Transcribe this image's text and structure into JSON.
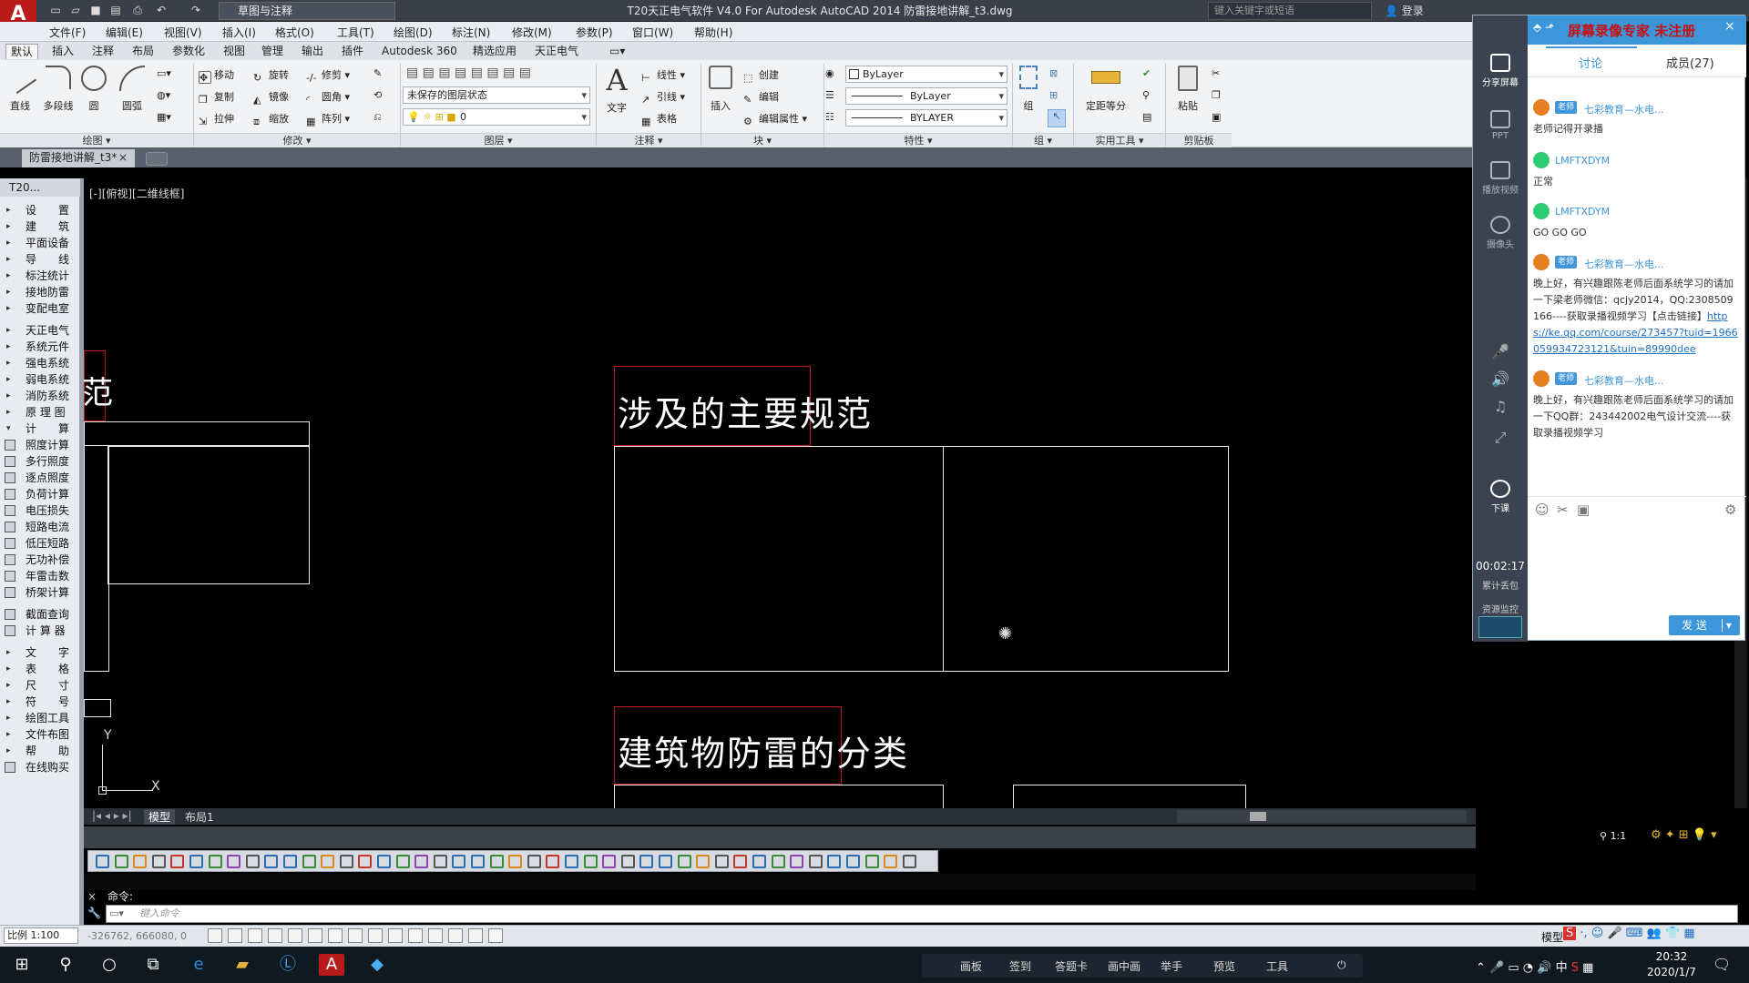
{
  "window": {
    "title": "T20天正电气软件 V4.0 For Autodesk AutoCAD 2014    防雷接地讲解_t3.dwg",
    "workspace": "草图与注释",
    "search_placeholder": "键入关键字或短语",
    "login": "登录",
    "logo": "A"
  },
  "menu": [
    "文件(F)",
    "编辑(E)",
    "视图(V)",
    "插入(I)",
    "格式(O)",
    "工具(T)",
    "绘图(D)",
    "标注(N)",
    "修改(M)",
    "参数(P)",
    "窗口(W)",
    "帮助(H)"
  ],
  "ribbon_tabs": [
    "默认",
    "插入",
    "注释",
    "布局",
    "参数化",
    "视图",
    "管理",
    "输出",
    "插件",
    "Autodesk 360",
    "精选应用",
    "天正电气"
  ],
  "ribbon": {
    "draw": {
      "panel": "绘图 ▾",
      "line": "直线",
      "polyline": "多段线",
      "circle": "圆",
      "arc": "圆弧"
    },
    "modify": {
      "panel": "修改 ▾",
      "move": "移动",
      "rotate": "旋转",
      "trim": "修剪",
      "copy": "复制",
      "mirror": "镜像",
      "fillet": "圆角",
      "stretch": "拉伸",
      "scale": "缩放",
      "array": "阵列"
    },
    "layers": {
      "panel": "图层 ▾",
      "layer_state": "未保存的图层状态",
      "current_layer": "0"
    },
    "annotation": {
      "panel": "注释 ▾",
      "text": "文字",
      "linear": "线性",
      "leader": "引线",
      "table": "表格"
    },
    "block": {
      "panel": "块 ▾",
      "insert": "插入",
      "create": "创建",
      "edit": "编辑",
      "edit_attr": "编辑属性"
    },
    "properties": {
      "panel": "特性 ▾",
      "color": "ByLayer",
      "linetype": "ByLayer",
      "lineweight": "BYLAYER"
    },
    "group": {
      "panel": "组 ▾",
      "group": "组"
    },
    "utilities": {
      "panel": "实用工具 ▾",
      "measure": "定距等分"
    },
    "clipboard": {
      "panel": "剪贴板",
      "paste": "粘贴"
    }
  },
  "doc_tab": {
    "label": "防雷接地讲解_t3*",
    "close": "×"
  },
  "view_label": "[-][俯视][二维线框]",
  "sidebar": {
    "title": "T20...",
    "items": [
      {
        "label": "设　　置",
        "kind": "arrow"
      },
      {
        "label": "建　　筑",
        "kind": "arrow"
      },
      {
        "label": "平面设备",
        "kind": "arrow"
      },
      {
        "label": "导　　线",
        "kind": "arrow"
      },
      {
        "label": "标注统计",
        "kind": "arrow"
      },
      {
        "label": "接地防雷",
        "kind": "arrow"
      },
      {
        "label": "变配电室",
        "kind": "arrow"
      },
      {
        "label": "天正电气",
        "kind": "arrow",
        "gap": true
      },
      {
        "label": "系统元件",
        "kind": "arrow"
      },
      {
        "label": "强电系统",
        "kind": "arrow"
      },
      {
        "label": "弱电系统",
        "kind": "arrow"
      },
      {
        "label": "消防系统",
        "kind": "arrow"
      },
      {
        "label": "原 理 图",
        "kind": "arrow"
      },
      {
        "label": "计　　算",
        "kind": "open"
      },
      {
        "label": "照度计算",
        "kind": "icon"
      },
      {
        "label": "多行照度",
        "kind": "icon"
      },
      {
        "label": "逐点照度",
        "kind": "icon"
      },
      {
        "label": "负荷计算",
        "kind": "icon"
      },
      {
        "label": "电压损失",
        "kind": "icon"
      },
      {
        "label": "短路电流",
        "kind": "icon"
      },
      {
        "label": "低压短路",
        "kind": "icon"
      },
      {
        "label": "无功补偿",
        "kind": "icon"
      },
      {
        "label": "年雷击数",
        "kind": "icon"
      },
      {
        "label": "桥架计算",
        "kind": "icon"
      },
      {
        "label": "截面查询",
        "kind": "icon",
        "gap": true
      },
      {
        "label": "计 算 器",
        "kind": "icon"
      },
      {
        "label": "文　　字",
        "kind": "arrow",
        "gap": true
      },
      {
        "label": "表　　格",
        "kind": "arrow"
      },
      {
        "label": "尺　　寸",
        "kind": "arrow"
      },
      {
        "label": "符　　号",
        "kind": "arrow"
      },
      {
        "label": "绘图工具",
        "kind": "arrow"
      },
      {
        "label": "文件布图",
        "kind": "arrow"
      },
      {
        "label": "帮　　助",
        "kind": "arrow"
      },
      {
        "label": "在线购买",
        "kind": "icon"
      }
    ]
  },
  "drawing": {
    "heading1": "涉及的主要规范",
    "heading2": "建筑物防雷的分类",
    "partial": "范",
    "ucs_y": "Y",
    "ucs_x": "X"
  },
  "layout_tabs": [
    "模型",
    "布局1"
  ],
  "status_strip": {
    "scale": "1:1"
  },
  "command": {
    "label": "命令:",
    "placeholder": "键入命令"
  },
  "statusbar": {
    "scale": "比例 1:100",
    "coords": "-326762, 666080, 0",
    "model": "模型"
  },
  "taskbar": {
    "live_items": [
      "画板",
      "签到",
      "答题卡",
      "画中画",
      "举手",
      "预览",
      "工具"
    ],
    "time": "20:32",
    "date": "2020/1/7",
    "tray_ime": "中"
  },
  "recorder": {
    "title": "屏幕录像专家  未注册",
    "tabs": [
      "讨论",
      "成员(27)"
    ],
    "left_buttons": [
      "分享屏幕",
      "PPT",
      "播放视频",
      "摄像头",
      "下课"
    ],
    "timer": "00:02:17",
    "stats1": "累计丢包",
    "stats2": "资源监控",
    "send": "发 送",
    "messages": [
      {
        "badge": "老师",
        "user": "七彩教育—水电...",
        "text": "老师记得开录播",
        "role": "teacher"
      },
      {
        "badge": "",
        "user": "LMFTXDYM",
        "text": "正常",
        "role": "student"
      },
      {
        "badge": "",
        "user": "LMFTXDYM",
        "text": "GO GO GO",
        "role": "student"
      },
      {
        "badge": "老师",
        "user": "七彩教育—水电...",
        "text": "晚上好，有兴趣跟陈老师后面系统学习的请加一下梁老师微信：qcjy2014，QQ:2308509166----获取录播视频学习【点击链接】",
        "link": "https://ke.qq.com/course/273457?tuid=1966059934723121&tuin=89990dee",
        "role": "teacher"
      },
      {
        "badge": "老师",
        "user": "七彩教育—水电...",
        "text": "晚上好，有兴趣跟陈老师后面系统学习的请加一下QQ群：243442002电气设计交流----获取录播视频学习",
        "role": "teacher"
      }
    ]
  },
  "colors": {
    "accent": "#3c96d9",
    "cad_bg": "#000000",
    "cad_red": "#c4161c",
    "brand_red": "#b91a1a"
  }
}
